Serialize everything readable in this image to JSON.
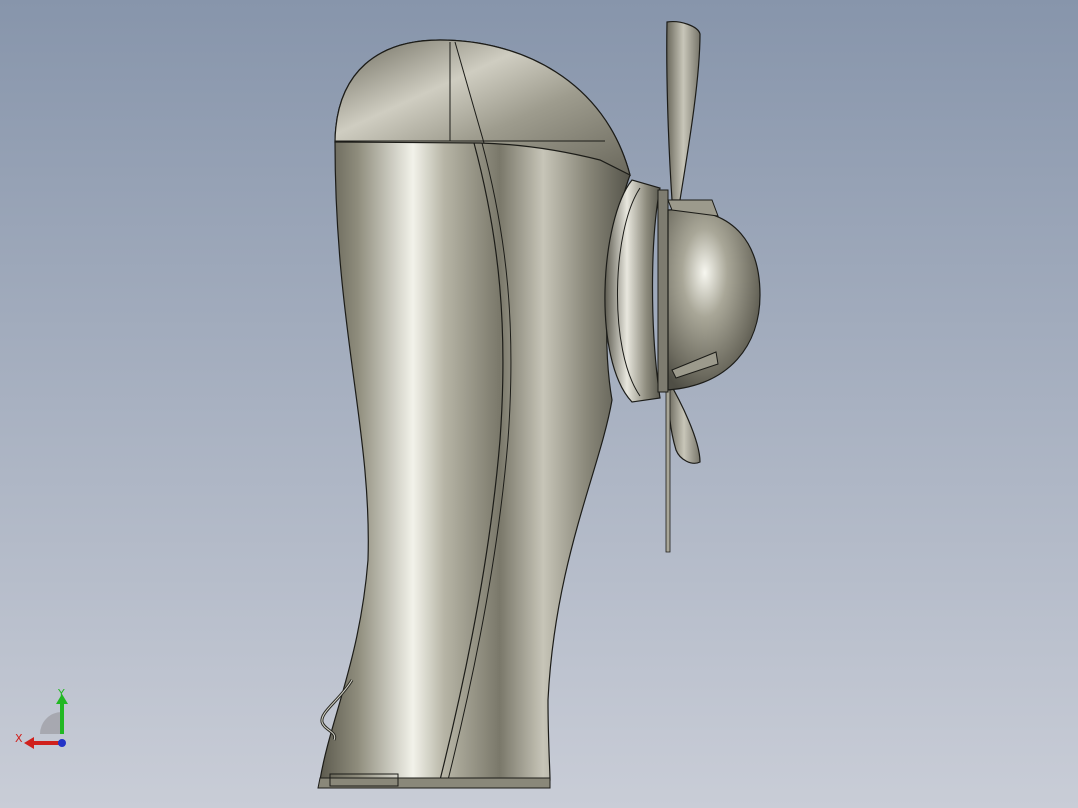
{
  "viewport": {
    "background_top": "#8795ab",
    "background_bottom": "#c9cdd7",
    "model_color": "#8e8c7c"
  },
  "triad": {
    "x_label": "X",
    "y_label": "Y",
    "x_color": "#d0201c",
    "y_color": "#22b823",
    "z_color": "#2433c7"
  }
}
